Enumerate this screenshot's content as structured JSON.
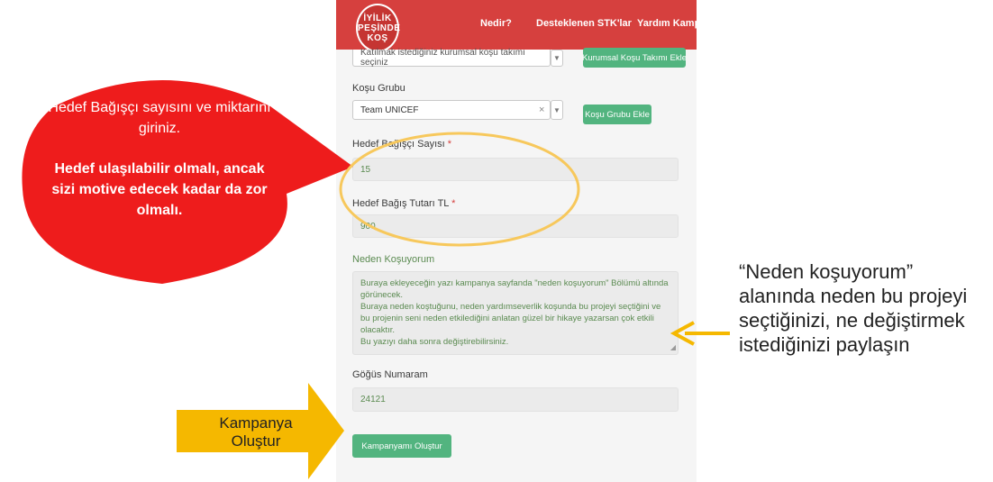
{
  "nav": {
    "logo_lines": [
      "İYİLİK",
      "PEŞİNDE",
      "KOŞ"
    ],
    "items": [
      "Nedir?",
      "Desteklenen STK'lar",
      "Yardım Kampanyaları"
    ]
  },
  "form": {
    "team_select_placeholder": "Katılmak istediğiniz kurumsal koşu takımı seçiniz",
    "corporate_team_add_button": "Kurumsal Koşu Takımı Ekle",
    "group_label": "Koşu Grubu",
    "group_value": "Team UNICEF",
    "group_add_button": "Koşu Grubu Ekle",
    "donor_count_label": "Hedef Bağışçı Sayısı",
    "donor_count_value": "15",
    "donation_amount_label": "Hedef Bağış Tutarı TL",
    "donation_amount_value": "900",
    "required_mark": "*",
    "why_label": "Neden Koşuyorum",
    "why_lines": [
      "Buraya ekleyeceğin yazı kampanya sayfanda \"neden koşuyorum\" Bölümü altında görünecek.",
      "Buraya neden koştuğunu, neden yardımseverlik koşunda bu projeyi seçtiğini ve bu projenin seni neden etkilediğini anlatan güzel bir hikaye yazarsan çok etkili olacaktır.",
      "Bu yazıyı daha sonra değiştirebilirsiniz."
    ],
    "bib_label": "Göğüs Numaram",
    "bib_value": "24121",
    "submit_button": "Kampanyamı Oluştur"
  },
  "callouts": {
    "bubble_line1": "Hedef Bağışçı sayısını ve miktarını giriniz.",
    "bubble_line2": "Hedef ulaşılabilir olmalı, ancak sizi motive edecek kadar da zor olmalı.",
    "right_note": "“Neden koşuyorum” alanında neden bu projeyi seçtiğinizi, ne değiştirmek istediğinizi paylaşın",
    "arrow_label": "Kampanya Oluştur"
  },
  "colors": {
    "nav_red": "#d6403e",
    "button_green": "#52b47f",
    "bubble_red": "#ee1c1c",
    "arrow_yellow": "#f5b800"
  }
}
